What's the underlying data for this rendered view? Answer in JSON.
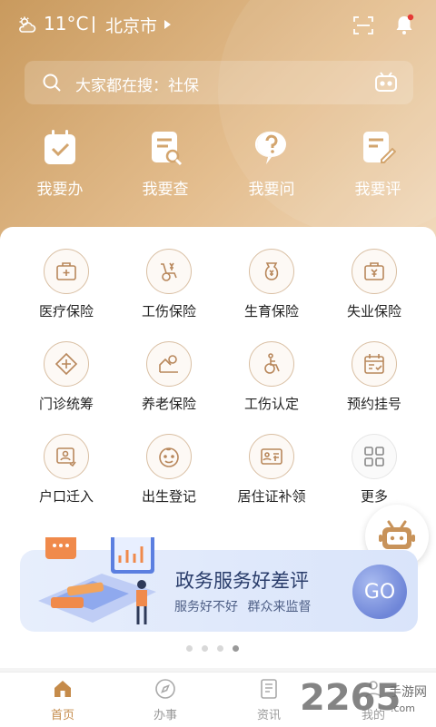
{
  "status": {
    "weather_icon": "cloudy-sun-icon",
    "temperature": "11°C",
    "city": "北京市"
  },
  "search": {
    "placeholder": "大家都在搜：社保"
  },
  "quick_actions": [
    {
      "label": "我要办",
      "icon": "calendar-check-icon"
    },
    {
      "label": "我要查",
      "icon": "document-search-icon"
    },
    {
      "label": "我要问",
      "icon": "question-chat-icon"
    },
    {
      "label": "我要评",
      "icon": "document-edit-icon"
    }
  ],
  "services": [
    {
      "label": "医疗保险",
      "icon": "medical-kit-icon"
    },
    {
      "label": "工伤保险",
      "icon": "wheelchair-yuan-icon"
    },
    {
      "label": "生育保险",
      "icon": "maternity-yuan-icon"
    },
    {
      "label": "失业保险",
      "icon": "briefcase-yuan-icon"
    },
    {
      "label": "门诊统筹",
      "icon": "diamond-plus-icon"
    },
    {
      "label": "养老保险",
      "icon": "elderly-icon"
    },
    {
      "label": "工伤认定",
      "icon": "wheelchair-icon"
    },
    {
      "label": "预约挂号",
      "icon": "calendar-icon"
    },
    {
      "label": "户口迁入",
      "icon": "id-transfer-icon"
    },
    {
      "label": "出生登记",
      "icon": "baby-face-icon"
    },
    {
      "label": "居住证补领",
      "icon": "id-card-icon"
    },
    {
      "label": "更多",
      "icon": "grid-more-icon"
    }
  ],
  "banner": {
    "title": "政务服务好差评",
    "subtitle": "服务好不好 群众来监督",
    "button": "GO"
  },
  "carousel": {
    "count": 4,
    "active_index": 3
  },
  "tabs": [
    {
      "label": "首页",
      "icon": "home-icon",
      "active": true
    },
    {
      "label": "办事",
      "icon": "compass-icon",
      "active": false
    },
    {
      "label": "资讯",
      "icon": "news-icon",
      "active": false
    },
    {
      "label": "我的",
      "icon": "user-icon",
      "active": false
    }
  ],
  "watermark": {
    "brand": "2265",
    "text": "手游网",
    "url": ".com"
  },
  "colors": {
    "accent": "#c58b4a",
    "hero_start": "#c99a5e",
    "hero_end": "#f2dcc0",
    "banner_text": "#2a3d6b"
  }
}
